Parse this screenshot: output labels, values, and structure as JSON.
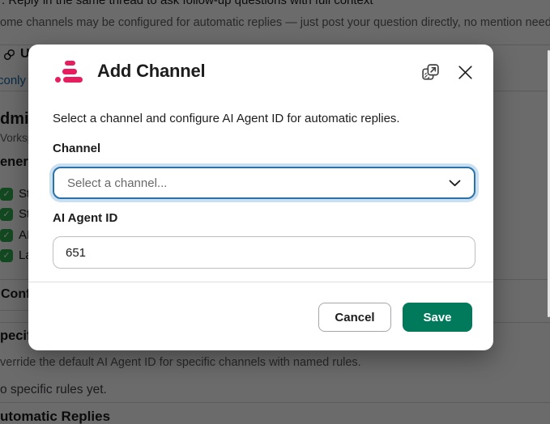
{
  "background": {
    "thread_tip": ". Reply in the same thread to ask follow-up questions with full context",
    "auto_reply_note": "ome channels may be configured for automatic replies — just post your question directly, no mention needed.",
    "useful_heading": "Us",
    "readonly_link": "conly",
    "admin_heading": "dmin",
    "workspace_subtitle": "Vorkspa",
    "general_heading": "enera",
    "checklist": [
      {
        "label": "Sto"
      },
      {
        "label": "Sto"
      },
      {
        "label": "AI A"
      },
      {
        "label": "Lan"
      }
    ],
    "config_heading": "Confi",
    "specific_heading": "pecifi",
    "override_note": "verride the default AI Agent ID for specific channels with named rules.",
    "no_rules_text": "o specific rules yet.",
    "automatic_heading": "utomatic Replies"
  },
  "modal": {
    "title": "Add Channel",
    "description": "Select a channel and configure AI Agent ID for automatic replies.",
    "channel_field": {
      "label": "Channel",
      "placeholder": "Select a channel..."
    },
    "agent_field": {
      "label": "AI Agent ID",
      "value": "651"
    },
    "footer": {
      "cancel_label": "Cancel",
      "save_label": "Save"
    },
    "colors": {
      "brand_pink": "#e61e5f",
      "save_green": "#007a5a",
      "focus_border": "#2b72a8",
      "focus_ring": "#c9dff2",
      "link_blue": "#1264a3",
      "check_green": "#2eae4e"
    }
  }
}
